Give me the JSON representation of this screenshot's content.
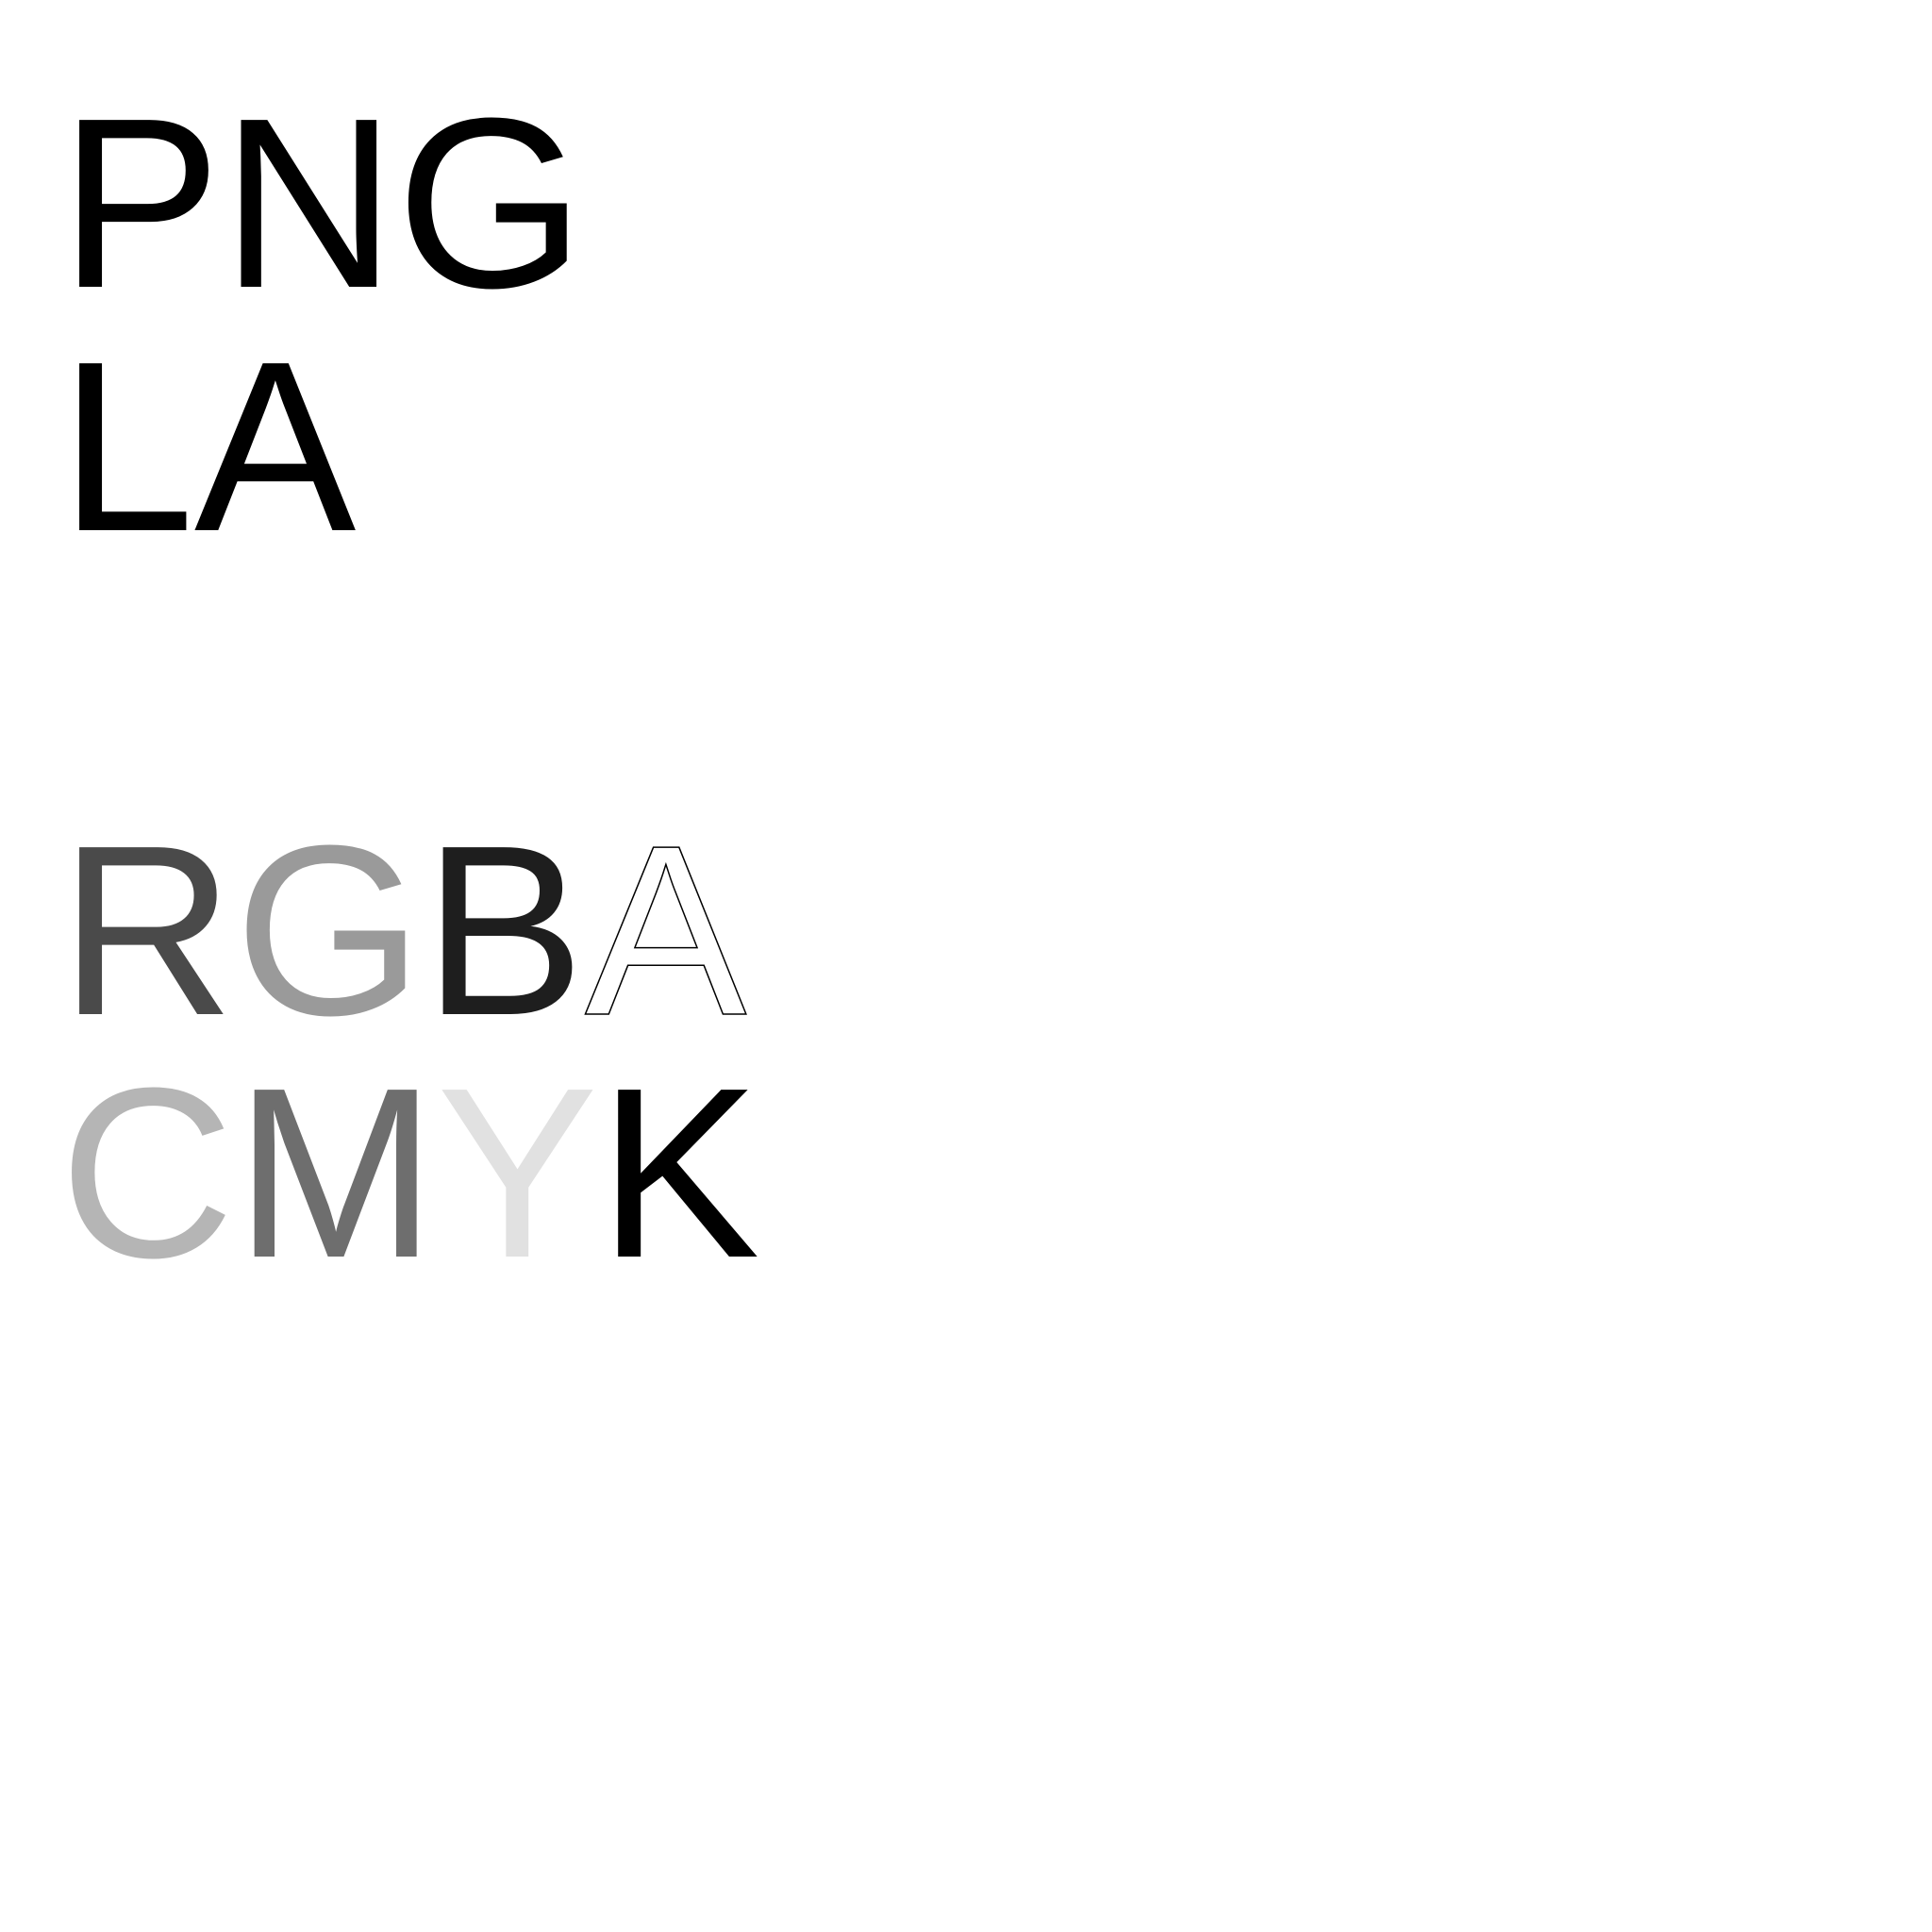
{
  "lines": {
    "png": {
      "text": "PNG",
      "color": "#000000"
    },
    "la": {
      "text": "LA",
      "color": "#000000"
    },
    "rgba": {
      "letters": [
        {
          "char": "R",
          "color": "#4a4a4a"
        },
        {
          "char": "G",
          "color": "#9a9a9a"
        },
        {
          "char": "B",
          "color": "#1e1e1e"
        },
        {
          "char": "A",
          "color": "#000000",
          "style": "outline"
        }
      ]
    },
    "cmyk": {
      "letters": [
        {
          "char": "C",
          "color": "#b5b5b5"
        },
        {
          "char": "M",
          "color": "#6e6e6e"
        },
        {
          "char": "Y",
          "color": "#e1e1e1"
        },
        {
          "char": "K",
          "color": "#000000"
        }
      ]
    }
  }
}
